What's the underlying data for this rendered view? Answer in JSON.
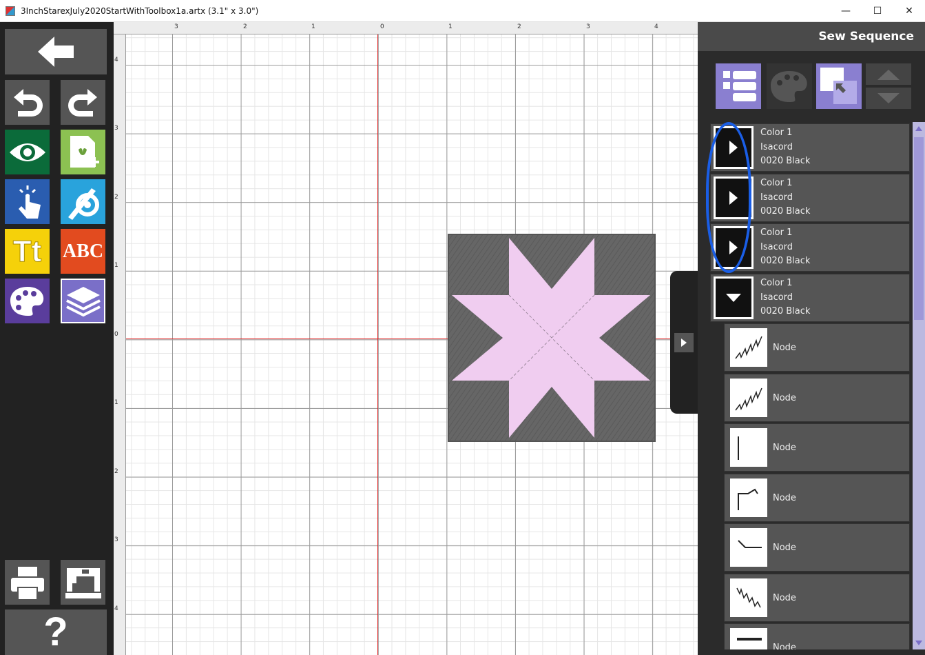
{
  "window": {
    "title": "3InchStarexJuly2020StartWithToolbox1a.artx (3.1\" x 3.0\")",
    "minimize": "—",
    "maximize": "☐",
    "close": "✕"
  },
  "toolbox": {
    "items": [
      "back-icon",
      "undo-icon",
      "redo-icon",
      "view-icon",
      "new-design-icon",
      "select-icon",
      "utilities-icon",
      "text-icon",
      "monogram-icon",
      "color-palette-icon",
      "layers-icon",
      "print-icon",
      "sewing-machine-icon",
      "help-icon"
    ],
    "text_label": "Tt",
    "monogram_label": "ABC",
    "help_label": "?"
  },
  "ruler": {
    "top_labels": [
      "3",
      "2",
      "1",
      "0",
      "1",
      "2",
      "3",
      "4"
    ],
    "left_labels": [
      "4",
      "3",
      "2",
      "1",
      "0",
      "1",
      "2",
      "3",
      "4"
    ]
  },
  "panel": {
    "title": "Sew Sequence",
    "colors": [
      {
        "name": "Color 1",
        "brand": "Isacord",
        "thread": "0020 Black",
        "state": "collapsed"
      },
      {
        "name": "Color 1",
        "brand": "Isacord",
        "thread": "0020 Black",
        "state": "collapsed"
      },
      {
        "name": "Color 1",
        "brand": "Isacord",
        "thread": "0020 Black",
        "state": "collapsed"
      },
      {
        "name": "Color 1",
        "brand": "Isacord",
        "thread": "0020 Black",
        "state": "expanded"
      }
    ],
    "nodes": [
      {
        "label": "Node",
        "thumb": "zigzag"
      },
      {
        "label": "Node",
        "thumb": "zigzag"
      },
      {
        "label": "Node",
        "thumb": "vertical-line"
      },
      {
        "label": "Node",
        "thumb": "corner"
      },
      {
        "label": "Node",
        "thumb": "bend"
      },
      {
        "label": "Node",
        "thumb": "zigzag"
      },
      {
        "label": "Node",
        "thumb": "bar"
      }
    ]
  },
  "colors": {
    "toolbox_bg": "#222222",
    "panel_accent": "#8a7fd0",
    "highlight_ring": "#1a5ee6",
    "design_fabric": "#666666",
    "design_star": "#f0cdf0"
  }
}
